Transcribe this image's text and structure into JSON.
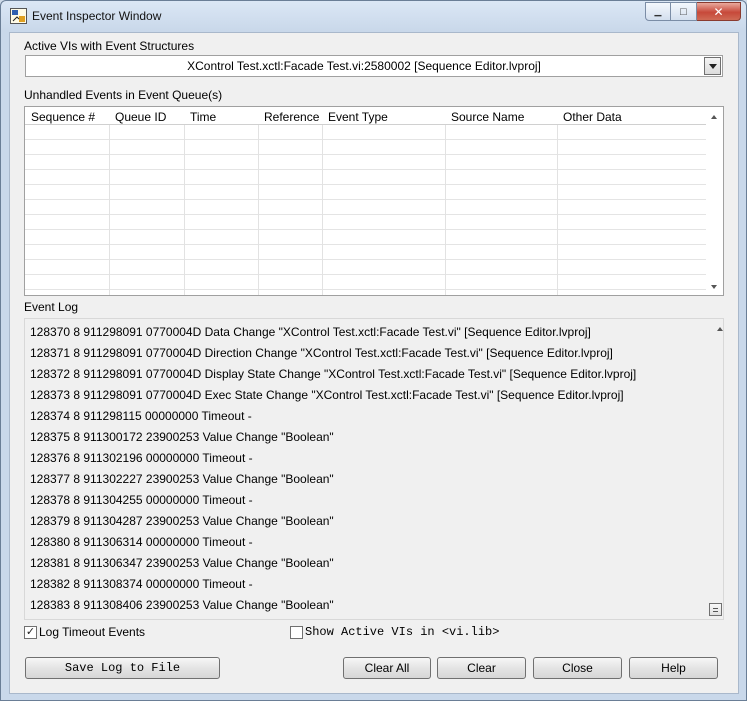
{
  "window": {
    "title": "Event Inspector Window",
    "minimize_glyph": "▁",
    "maximize_glyph": "□",
    "close_glyph": "✕"
  },
  "active_vis": {
    "label": "Active VIs with Event Structures",
    "selected": "XControl Test.xctl:Facade Test.vi:2580002 [Sequence Editor.lvproj]"
  },
  "queue": {
    "label": "Unhandled Events in Event Queue(s)",
    "columns": [
      "Sequence #",
      "Queue ID",
      "Time",
      "Reference",
      "Event Type",
      "Source Name",
      "Other Data"
    ],
    "rows": []
  },
  "event_log": {
    "label": "Event Log",
    "lines": [
      "128370 8 911298091 0770004D Data Change \"XControl Test.xctl:Facade Test.vi\" [Sequence Editor.lvproj]",
      "128371 8 911298091 0770004D Direction Change \"XControl Test.xctl:Facade Test.vi\" [Sequence Editor.lvproj]",
      "128372 8 911298091 0770004D Display State Change \"XControl Test.xctl:Facade Test.vi\" [Sequence Editor.lvproj]",
      "128373 8 911298091 0770004D Exec State Change \"XControl Test.xctl:Facade Test.vi\" [Sequence Editor.lvproj]",
      "128374 8 911298115 00000000 Timeout -",
      "128375 8 911300172 23900253 Value Change \"Boolean\"",
      "128376 8 911302196 00000000 Timeout -",
      "128377 8 911302227 23900253 Value Change \"Boolean\"",
      "128378 8 911304255 00000000 Timeout -",
      "128379 8 911304287 23900253 Value Change \"Boolean\"",
      "128380 8 911306314 00000000 Timeout -",
      "128381 8 911306347 23900253 Value Change \"Boolean\"",
      "128382 8 911308374 00000000 Timeout -",
      "128383 8 911308406 23900253 Value Change \"Boolean\""
    ]
  },
  "options": {
    "log_timeout_label": "Log Timeout Events",
    "log_timeout_checked": true,
    "check_glyph": "✓",
    "show_vilib_label": "Show Active VIs in <vi.lib>",
    "show_vilib_checked": false
  },
  "buttons": {
    "save_log": "Save Log to File",
    "clear_all": "Clear All",
    "clear": "Clear",
    "close": "Close",
    "help": "Help"
  }
}
